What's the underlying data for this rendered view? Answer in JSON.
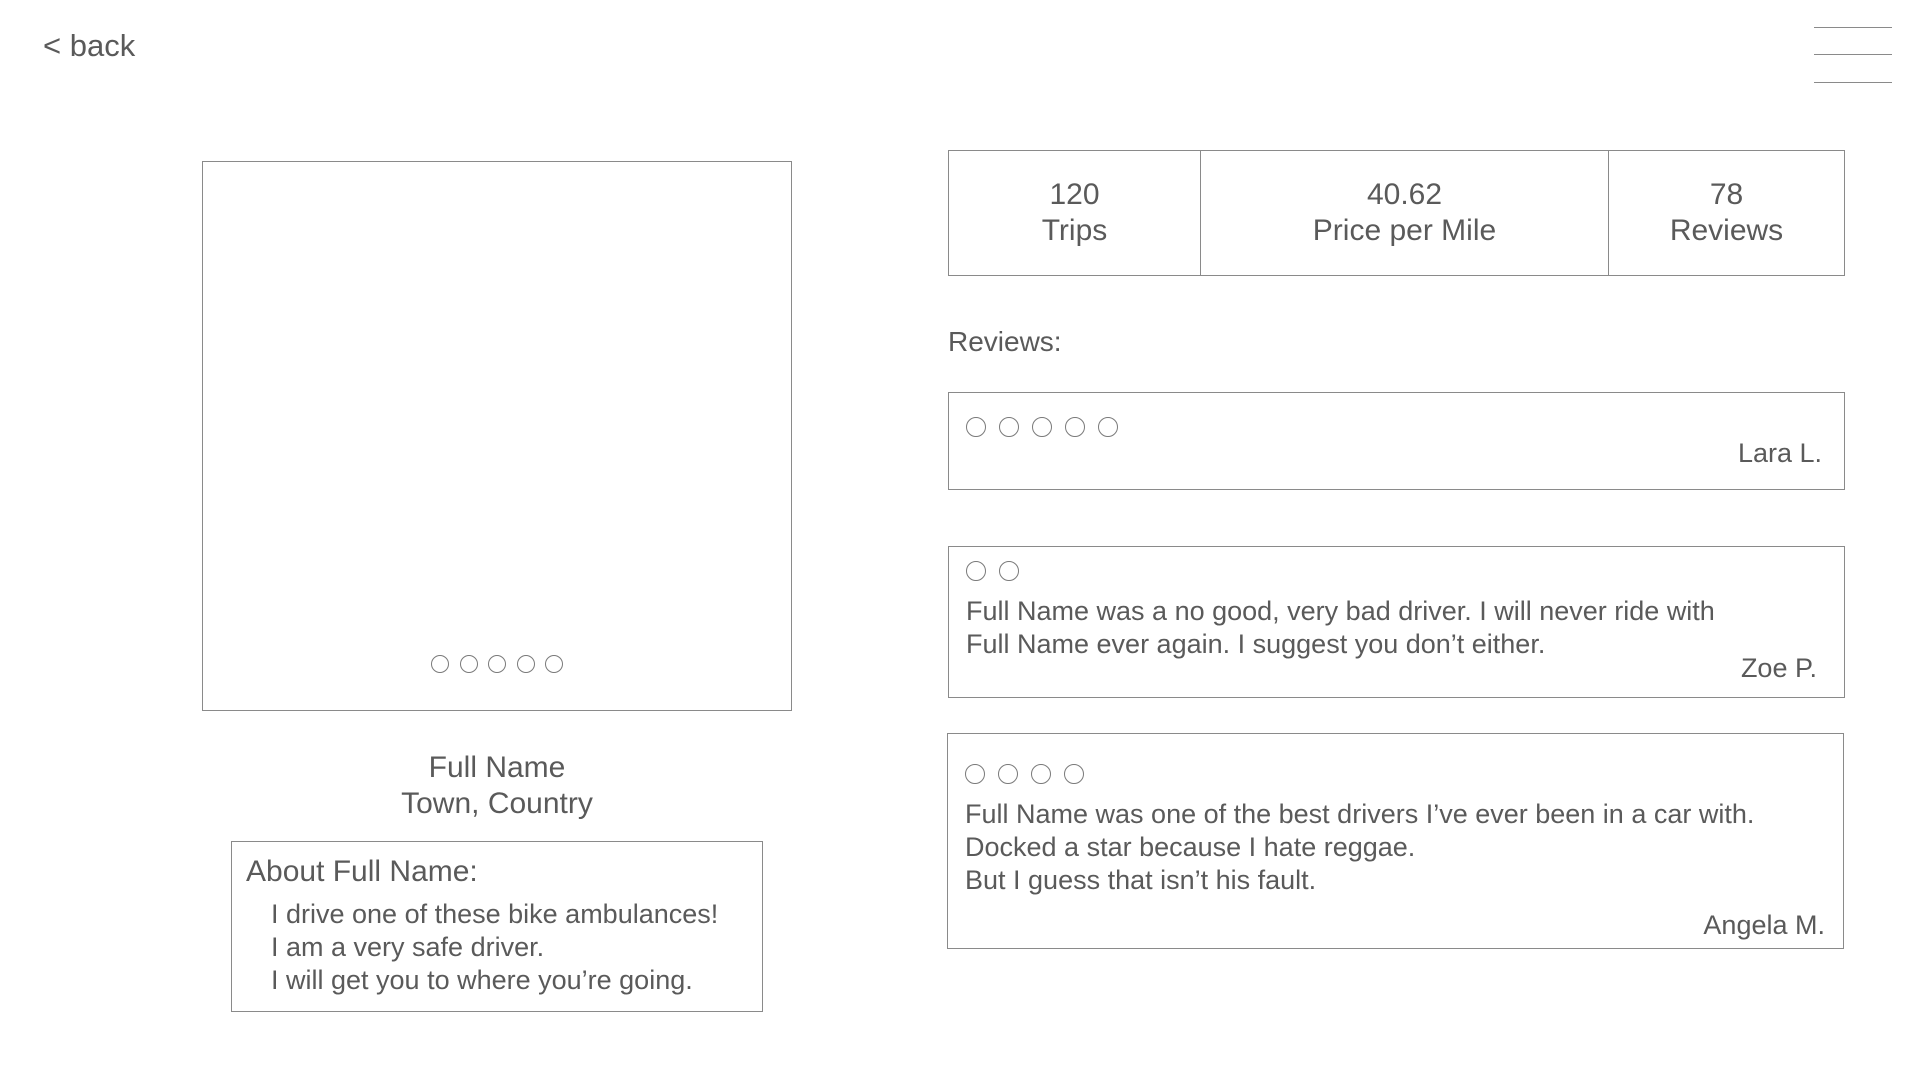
{
  "nav": {
    "back_label": "< back",
    "menu_icon": "hamburger-menu-icon"
  },
  "profile": {
    "photo_carousel_slides": 5,
    "name": "Full Name",
    "location": "Town, Country",
    "about_title": "About Full Name:",
    "about_lines": [
      "I drive one of these bike ambulances!",
      "I am a very safe driver.",
      "I will get you to where you’re going."
    ]
  },
  "stats": [
    {
      "value": "120",
      "label": "Trips"
    },
    {
      "value": "40.62",
      "label": "Price per Mile"
    },
    {
      "value": "78",
      "label": "Reviews"
    }
  ],
  "reviews_heading": "Reviews:",
  "reviews": [
    {
      "rating": 5,
      "lines": [],
      "author": "Lara L."
    },
    {
      "rating": 2,
      "lines": [
        "Full Name was a no good, very bad driver. I will never ride with",
        "Full Name ever again. I suggest you don’t either."
      ],
      "author": "Zoe P."
    },
    {
      "rating": 4,
      "lines": [
        "Full Name was one of the best drivers I’ve ever been in a car with.",
        "Docked a star because I hate reggae.",
        "But I guess that isn’t his fault."
      ],
      "author": "Angela M."
    }
  ],
  "colors": {
    "text": "#5a5a5a",
    "border": "#8a8a8a",
    "background": "#ffffff"
  }
}
